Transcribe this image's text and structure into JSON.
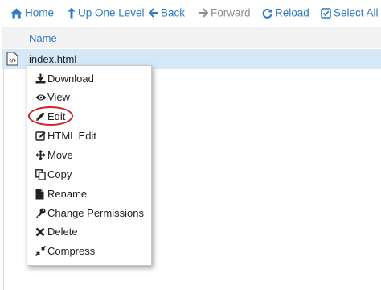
{
  "toolbar": {
    "home_label": "Home",
    "up_label": "Up One Level",
    "back_label": "Back",
    "forward_label": "Forward",
    "reload_label": "Reload",
    "select_all_label": "Select All"
  },
  "file_list": {
    "header_name": "Name",
    "rows": [
      {
        "name": "index.html",
        "icon": "html-file-icon",
        "selected": true
      }
    ]
  },
  "context_menu": {
    "items": [
      {
        "label": "Download",
        "icon": "download-icon"
      },
      {
        "label": "View",
        "icon": "eye-icon"
      },
      {
        "label": "Edit",
        "icon": "pencil-icon",
        "highlighted": true
      },
      {
        "label": "HTML Edit",
        "icon": "html-edit-icon"
      },
      {
        "label": "Move",
        "icon": "move-arrows-icon"
      },
      {
        "label": "Copy",
        "icon": "copy-icon"
      },
      {
        "label": "Rename",
        "icon": "file-icon"
      },
      {
        "label": "Change Permissions",
        "icon": "key-icon"
      },
      {
        "label": "Delete",
        "icon": "close-icon"
      },
      {
        "label": "Compress",
        "icon": "compress-icon"
      }
    ]
  },
  "colors": {
    "accent": "#2e7cc6",
    "disabled": "#8f8f8f",
    "selected_row": "#d4e8f7",
    "highlight_ring": "#d0202a"
  }
}
